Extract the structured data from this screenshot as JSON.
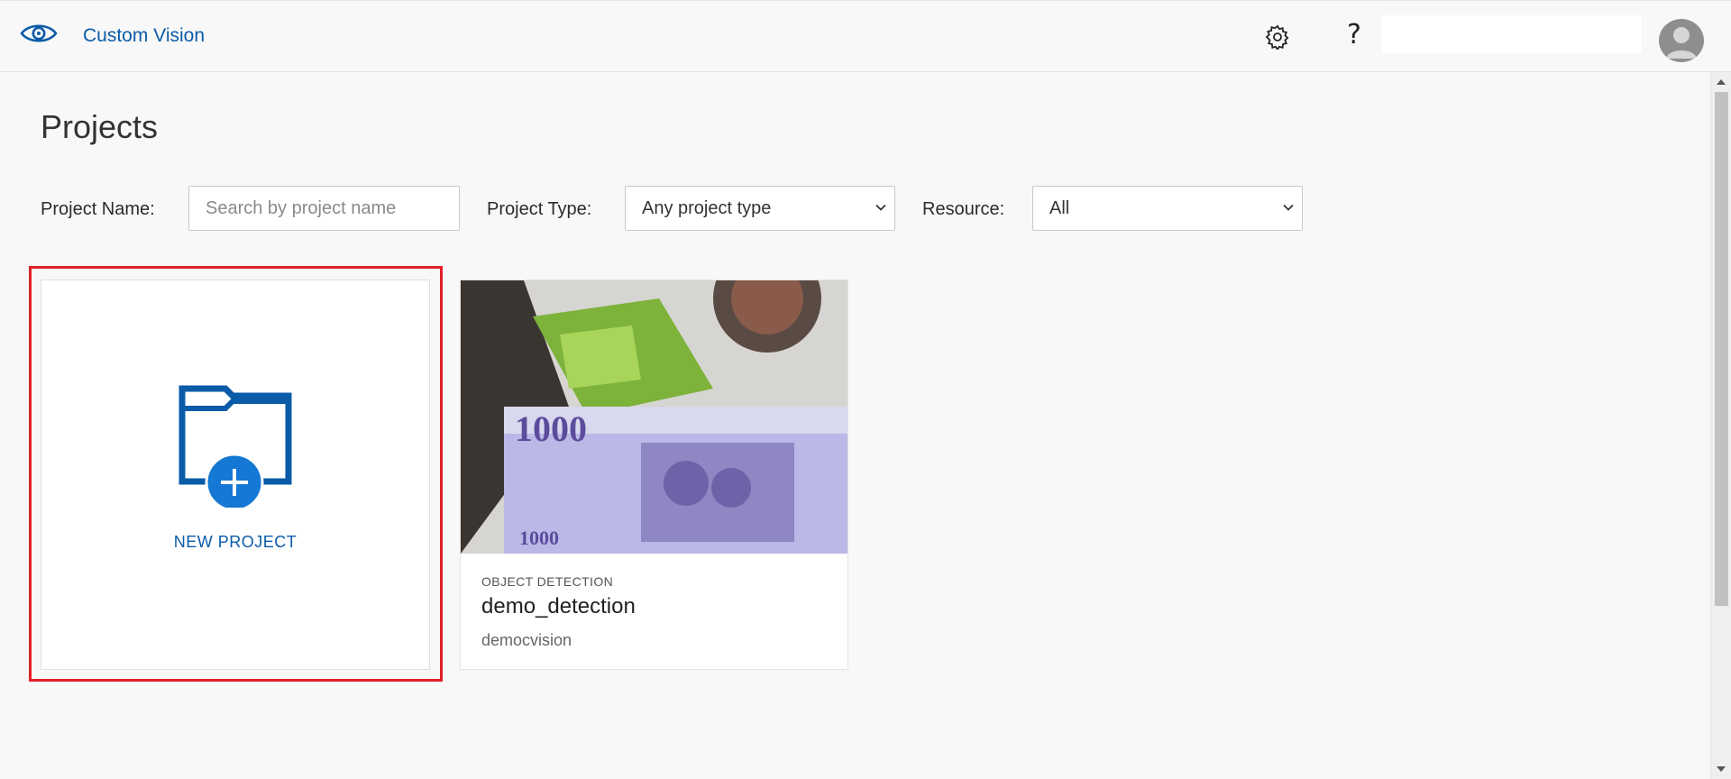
{
  "header": {
    "app_name": "Custom Vision",
    "help_glyph": "?",
    "icons": [
      "eye-icon",
      "gear-icon",
      "help-icon",
      "avatar-icon"
    ]
  },
  "page": {
    "title": "Projects"
  },
  "filters": {
    "name_label": "Project Name:",
    "name_placeholder": "Search by project name",
    "type_label": "Project Type:",
    "type_value": "Any project type",
    "resource_label": "Resource:",
    "resource_value": "All"
  },
  "new_project": {
    "label": "NEW PROJECT",
    "icon": "new-folder-plus-icon"
  },
  "projects": [
    {
      "type": "OBJECT DETECTION",
      "name": "demo_detection",
      "resource": "democvision"
    }
  ],
  "colors": {
    "accent": "#0a5ba8",
    "plus_circle": "#1478d4",
    "highlight": "#e02028"
  }
}
